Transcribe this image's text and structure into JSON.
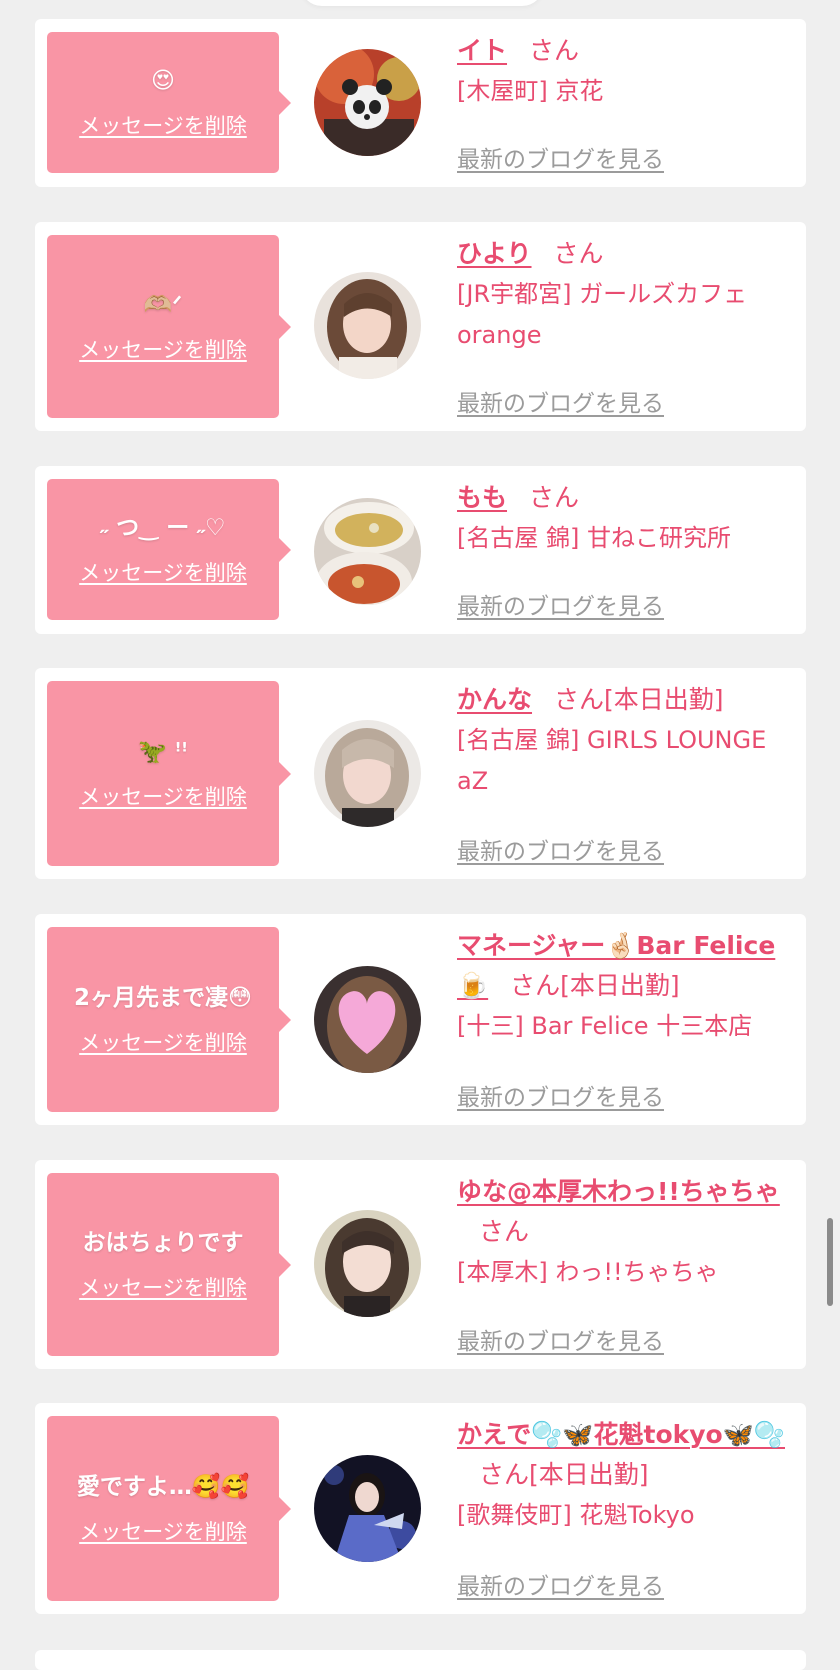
{
  "ui": {
    "delete_label": "メッセージを削除",
    "blog_label": "最新のブログを見る",
    "honorific": "さん"
  },
  "colors": {
    "background": "#efefef",
    "bubble": "#f995a5",
    "accent": "#e84c70",
    "link_gray": "#9b9b9b"
  },
  "cards": [
    {
      "message": "😍",
      "name": "イト",
      "working": "",
      "shop": "[木屋町] 京花",
      "avatar_icon": "panda-mask-photo"
    },
    {
      "message": "🫶🏼ᐟ‪‪",
      "name": "ひより",
      "working": "",
      "shop": "[JR宇都宮] ガールズカフェ orange",
      "avatar_icon": "girl-portrait-photo"
    },
    {
      "message": "˶ つ‿ ー ˶♡",
      "name": "もも",
      "working": "",
      "shop": "[名古屋 錦] 甘ねこ研究所",
      "avatar_icon": "ramen-bowl-photo"
    },
    {
      "message": "🦖 ꜝꜝ",
      "name": "かんな",
      "working": "[本日出勤]",
      "shop": "[名古屋 錦] GIRLS LOUNGE aZ",
      "avatar_icon": "girl-portrait-photo"
    },
    {
      "message": "2ヶ月先まで凄😳",
      "name": "マネージャー🤞🏻Bar Felice🍺",
      "working": "[本日出勤]",
      "shop": "[十三] Bar Felice 十三本店",
      "avatar_icon": "heart-covered-photo"
    },
    {
      "message": "おはちょりです",
      "name": "ゆな@本厚木わっ!!ちゃちゃ",
      "working": "",
      "shop": "[本厚木] わっ!!ちゃちゃ",
      "avatar_icon": "girl-portrait-photo"
    },
    {
      "message": "愛ですよ…🥰🥰",
      "name": "かえで🫧🦋花魁tokyo🦋🫧",
      "working": "[本日出勤]",
      "shop": "[歌舞伎町] 花魁Tokyo",
      "avatar_icon": "kimono-portrait-photo"
    }
  ]
}
